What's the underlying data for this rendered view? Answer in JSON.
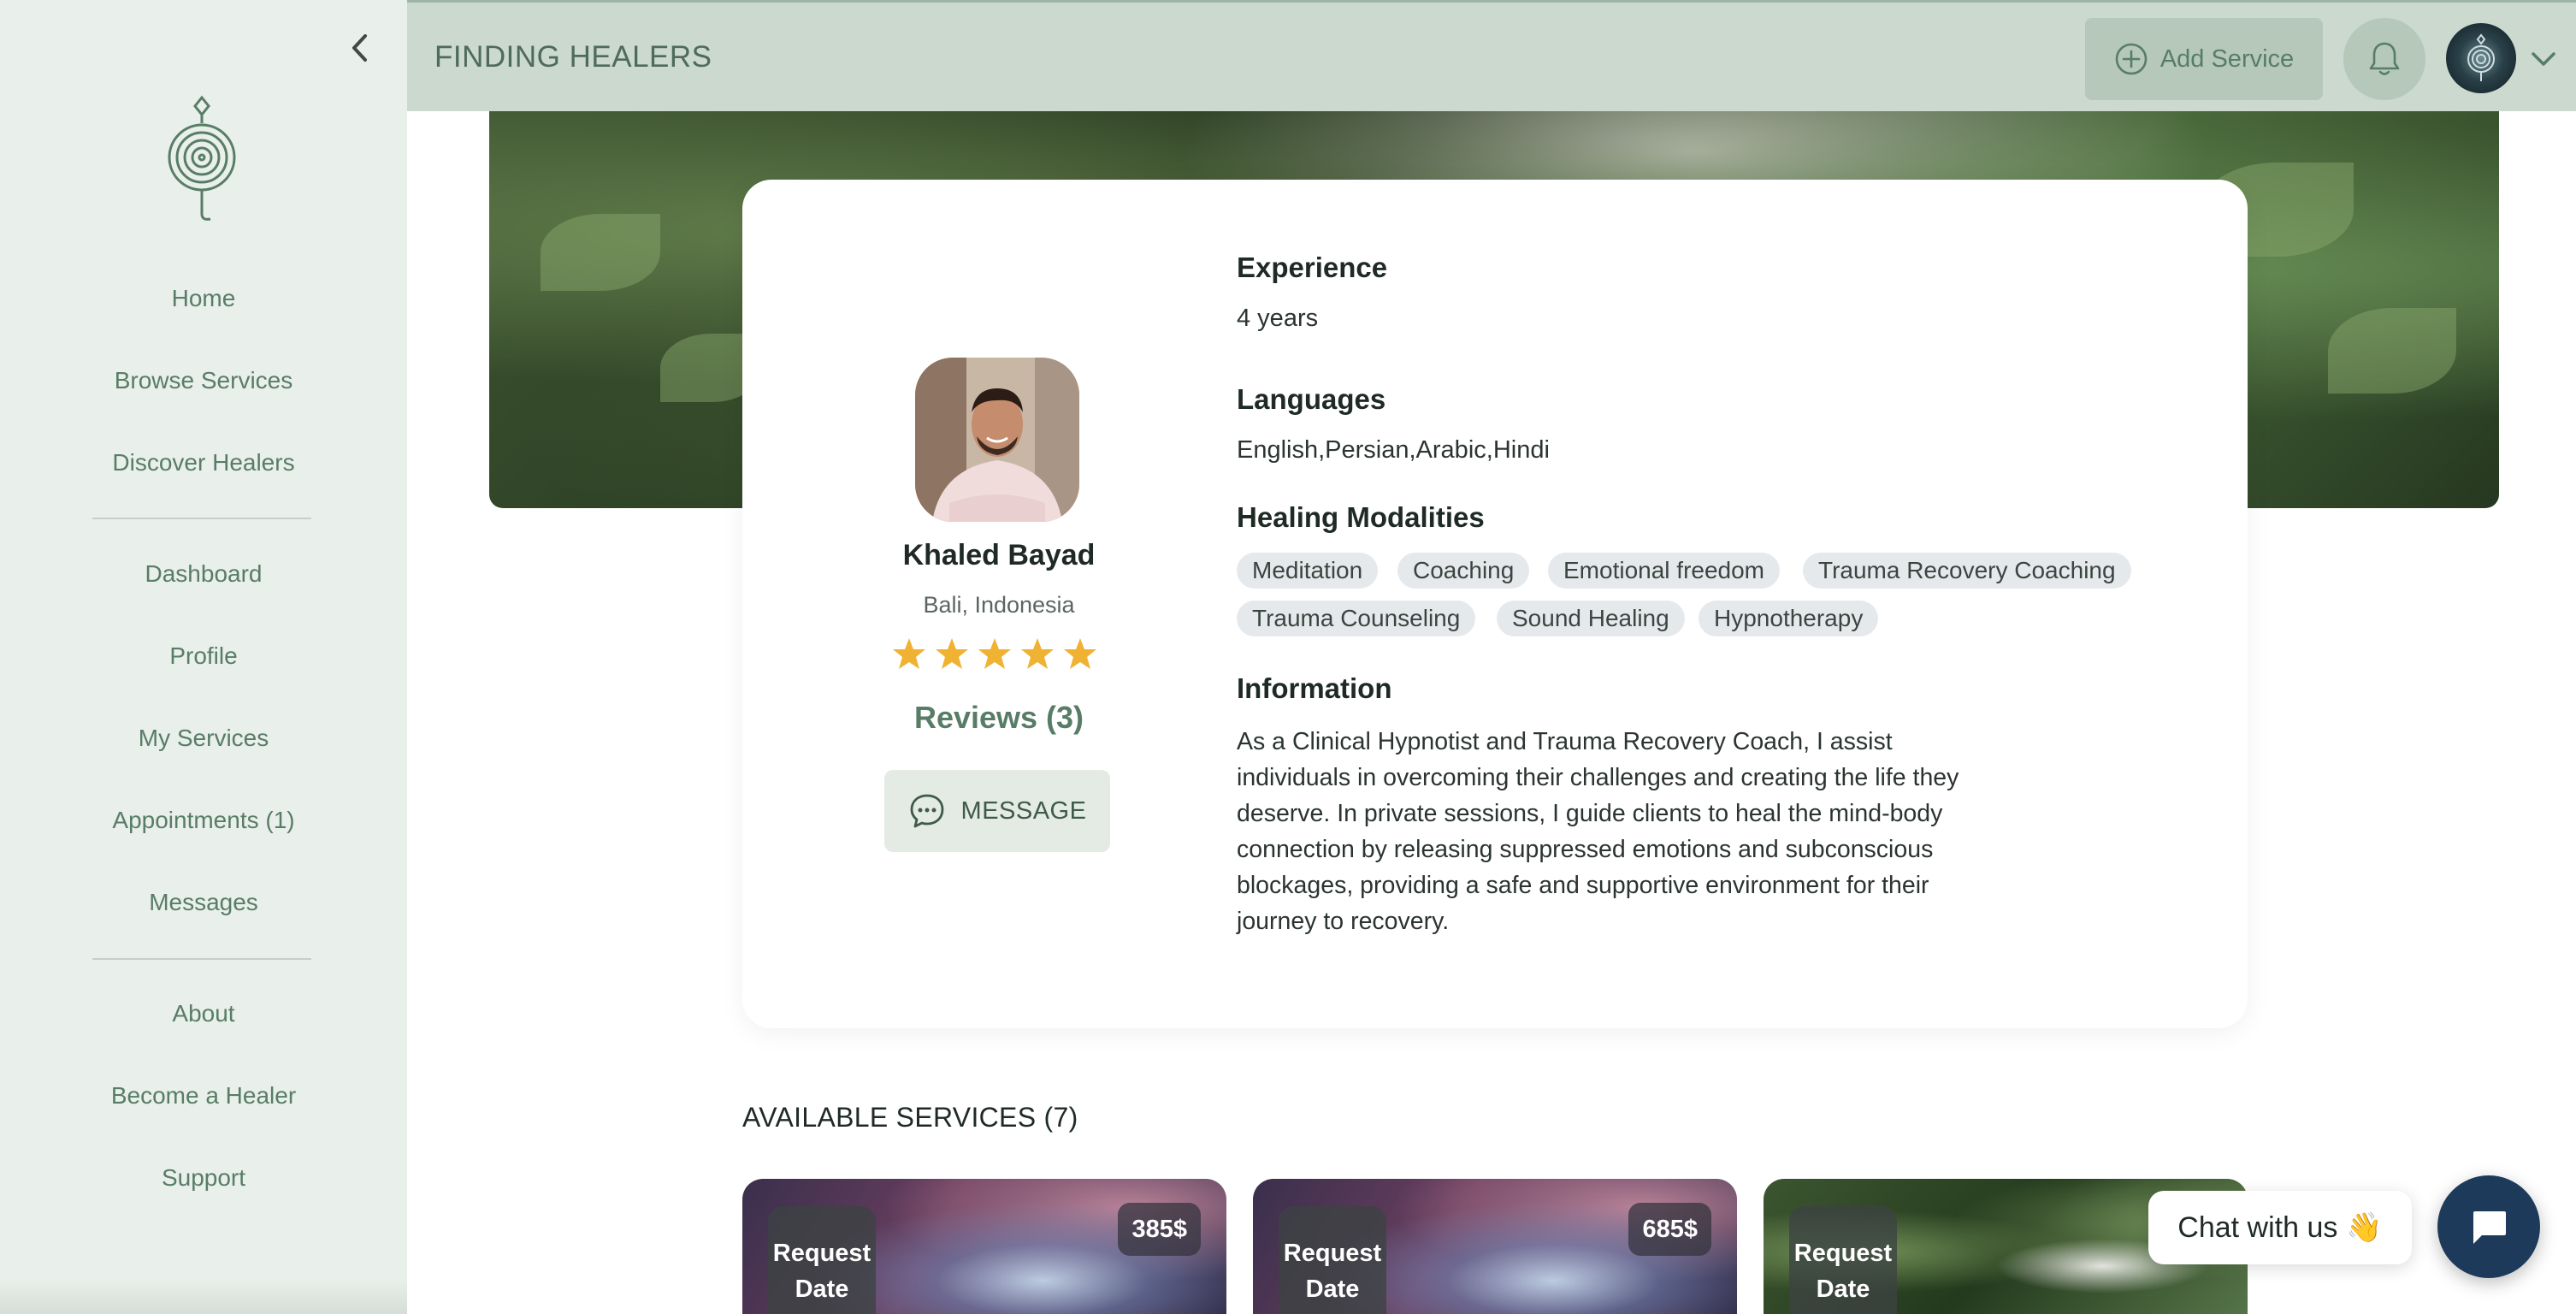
{
  "header": {
    "title": "FINDING HEALERS",
    "add_service_label": "Add Service"
  },
  "sidebar": {
    "items": [
      {
        "label": "Home"
      },
      {
        "label": "Browse Services"
      },
      {
        "label": "Discover Healers"
      },
      {
        "label": "Dashboard"
      },
      {
        "label": "Profile"
      },
      {
        "label": "My Services"
      },
      {
        "label": "Appointments (1)"
      },
      {
        "label": "Messages"
      },
      {
        "label": "About"
      },
      {
        "label": "Become a Healer"
      },
      {
        "label": "Support"
      }
    ]
  },
  "profile": {
    "name": "Khaled Bayad",
    "location": "Bali, Indonesia",
    "rating": 5,
    "rating_max": 5,
    "reviews_label": "Reviews (3)",
    "message_label": "MESSAGE",
    "experience_heading": "Experience",
    "experience_value": "4 years",
    "languages_heading": "Languages",
    "languages_value": "English,Persian,Arabic,Hindi",
    "modalities_heading": "Healing Modalities",
    "modalities": [
      "Meditation",
      "Coaching",
      "Emotional freedom",
      "Trauma Recovery Coaching",
      "Trauma Counseling",
      "Sound Healing",
      "Hypnotherapy"
    ],
    "information_heading": "Information",
    "information_text": "As a Clinical Hypnotist and Trauma Recovery Coach, I assist individuals in overcoming their challenges and creating the life they deserve. In private sessions, I guide clients to heal the mind-body connection by releasing suppressed emotions and subconscious blockages, providing a safe and supportive environment for their journey to recovery."
  },
  "services": {
    "heading": "AVAILABLE SERVICES (7)",
    "cards": [
      {
        "request_label": "Request Date",
        "price": "385$"
      },
      {
        "request_label": "Request Date",
        "price": "685$"
      },
      {
        "request_label": "Request Date",
        "price": ""
      }
    ]
  },
  "chat": {
    "label": "Chat with us",
    "emoji": "👋"
  },
  "colors": {
    "sidebar_bg": "#e9efea",
    "topbar_bg": "#cbd9ce",
    "accent_green": "#587d66",
    "star": "#f0b232",
    "chat_launcher": "#1d3a5a"
  },
  "icons": [
    "chevron-left-icon",
    "spiral-logo-icon",
    "plus-circle-icon",
    "bell-icon",
    "chevron-down-icon",
    "star-icon",
    "chat-bubble-icon",
    "messenger-icon"
  ]
}
